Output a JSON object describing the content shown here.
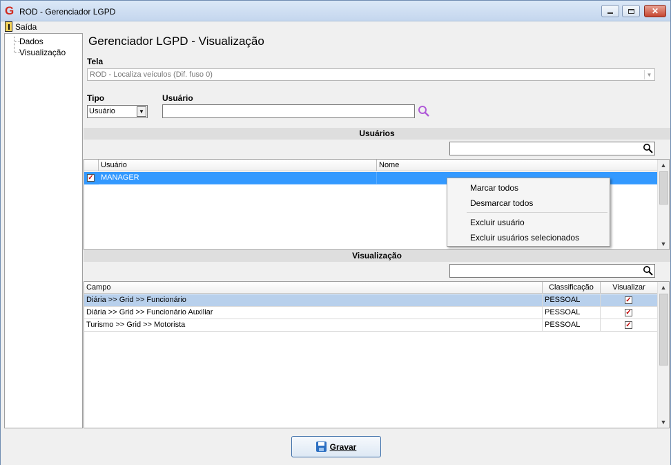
{
  "window": {
    "title": "ROD - Gerenciador LGPD"
  },
  "menu": {
    "exit": "Saída"
  },
  "tree": {
    "items": [
      "Dados",
      "Visualização"
    ]
  },
  "main": {
    "heading": "Gerenciador LGPD - Visualização",
    "tela_label": "Tela",
    "tela_value": "ROD - Localiza veículos (Dif. fuso 0)",
    "tipo_label": "Tipo",
    "tipo_value": "Usuário",
    "usuario_label": "Usuário",
    "usuario_value": ""
  },
  "users_section": {
    "title": "Usuários",
    "search_value": "",
    "columns": [
      "Usuário",
      "Nome"
    ],
    "rows": [
      {
        "usuario": "MANAGER",
        "nome": "",
        "checked": true,
        "selected": true
      }
    ]
  },
  "context_menu": {
    "items": [
      "Marcar todos",
      "Desmarcar todos",
      "Excluir usuário",
      "Excluir usuários selecionados"
    ]
  },
  "view_section": {
    "title": "Visualização",
    "search_value": "",
    "columns": [
      "Campo",
      "Classificação",
      "Visualizar"
    ],
    "rows": [
      {
        "campo": "Diária >> Grid >> Funcionário",
        "classificacao": "PESSOAL",
        "visualizar": true
      },
      {
        "campo": "Diária >> Grid >> Funcionário Auxiliar",
        "classificacao": "PESSOAL",
        "visualizar": true
      },
      {
        "campo": "Turismo >> Grid >> Motorista",
        "classificacao": "PESSOAL",
        "visualizar": true
      }
    ]
  },
  "footer": {
    "save_label": "Gravar"
  },
  "colors": {
    "selection": "#3399ff",
    "row_highlight": "#b8d0ec",
    "check": "#c00000",
    "magnifier": "#b05ad8"
  },
  "icons": {
    "app": "app-logo-icon",
    "exit": "exit-door-icon",
    "search": "magnifier-icon",
    "save": "floppy-disk-icon"
  }
}
